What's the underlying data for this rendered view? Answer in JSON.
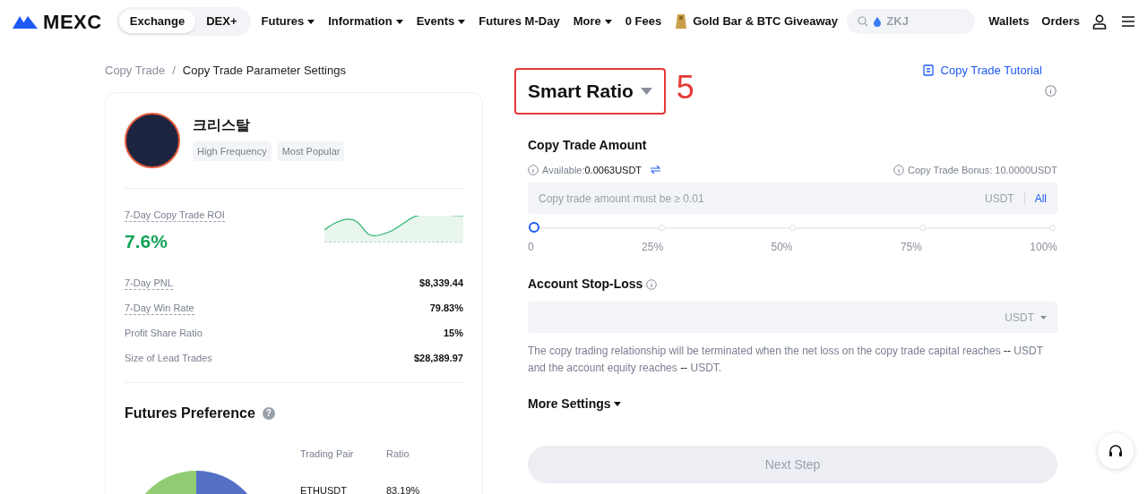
{
  "header": {
    "logo": "MEXC",
    "segments": [
      {
        "label": "Exchange",
        "selected": true
      },
      {
        "label": "DEX+",
        "selected": false
      }
    ],
    "nav": [
      {
        "label": "Futures",
        "dropdown": true
      },
      {
        "label": "Information",
        "dropdown": true
      },
      {
        "label": "Events",
        "dropdown": true
      },
      {
        "label": "Futures M-Day",
        "dropdown": false
      },
      {
        "label": "More",
        "dropdown": true
      },
      {
        "label": "0 Fees",
        "dropdown": false
      },
      {
        "label": "Gold Bar & BTC Giveaway",
        "dropdown": false,
        "kind": "promo"
      }
    ],
    "search": {
      "placeholder": "ZKJ"
    },
    "links": [
      "Wallets",
      "Orders"
    ]
  },
  "breadcrumb": {
    "items": [
      "Copy Trade",
      "Copy Trade Parameter Settings"
    ],
    "separator": "/"
  },
  "tutorial_link": "Copy Trade Tutorial",
  "trader": {
    "name": "크리스탈",
    "tags": [
      "High Frequency",
      "Most Popular"
    ],
    "roi_label": "7-Day Copy Trade ROI",
    "roi": "7.6%",
    "stats": [
      {
        "label": "7-Day PNL",
        "value": "$8,339.44",
        "underlined": true
      },
      {
        "label": "7-Day Win Rate",
        "value": "79.83%",
        "underlined": true
      },
      {
        "label": "Profit Share Ratio",
        "value": "15%",
        "underlined": false
      },
      {
        "label": "Size of Lead Trades",
        "value": "$28,389.97",
        "underlined": false
      }
    ]
  },
  "futures_preference": {
    "title": "Futures Preference",
    "help_icon": "?",
    "columns": [
      "Trading Pair",
      "Ratio"
    ],
    "rows": [
      [
        "ETHUSDT",
        "83.19%"
      ]
    ]
  },
  "mode": {
    "label": "Smart Ratio",
    "annotation": "5"
  },
  "amount": {
    "title": "Copy Trade Amount",
    "available_label": "Available:",
    "available_value": "0.0063USDT",
    "bonus": "Copy Trade Bonus: 10.0000USDT",
    "placeholder": "Copy trade amount must be ≥ 0.01",
    "unit": "USDT",
    "all": "All",
    "level": 0,
    "ticks": [
      "0",
      "25%",
      "50%",
      "75%",
      "100%"
    ]
  },
  "stop_loss": {
    "title": "Account Stop-Loss",
    "unit": "USDT",
    "note": "The copy trading relationship will be terminated when the net loss on the copy trade capital reaches **--** USDT and the account equity reaches **--** USDT."
  },
  "more_settings": "More Settings",
  "next_button": {
    "label": "Next Step",
    "disabled": true
  }
}
